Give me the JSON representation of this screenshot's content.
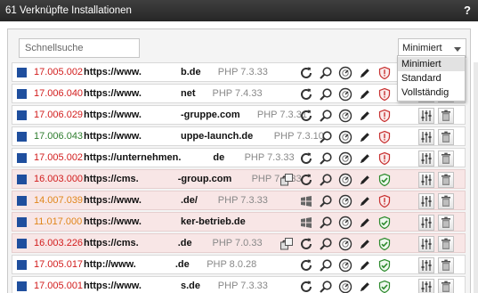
{
  "window": {
    "title": "61 Verknüpfte Installationen",
    "help": "?"
  },
  "search": {
    "placeholder": "Schnellsuche",
    "value": ""
  },
  "view_select": {
    "value": "Minimiert",
    "options": [
      "Minimiert",
      "Standard",
      "Vollständig"
    ],
    "highlighted": "Minimiert"
  },
  "colors": {
    "red": "#d21d1d",
    "green": "#2e7d2e",
    "orange": "#e0861a",
    "blue_square": "#1f4f9e",
    "alt_row": "#f8e6e6",
    "titlebar": "#2e2e2e"
  },
  "rows": [
    {
      "version": "17.005.002",
      "version_color": "red",
      "url": "https://www.",
      "url_tail": "b.de",
      "php": "PHP 7.3.33",
      "alt": false,
      "icons": [
        "refresh-icon",
        "search-icon",
        "dashboard-icon",
        "pencil-icon",
        "shield-warning-icon"
      ]
    },
    {
      "version": "17.006.040",
      "version_color": "red",
      "url": "https://www.",
      "url_tail": "net",
      "php": "PHP 7.4.33",
      "alt": false,
      "icons": [
        "refresh-icon",
        "search-icon",
        "dashboard-icon",
        "pencil-icon",
        "shield-warning-icon"
      ]
    },
    {
      "version": "17.006.029",
      "version_color": "red",
      "url": "https://www.",
      "url_tail": "-gruppe.com",
      "php": "PHP 7.3.31",
      "alt": false,
      "icons": [
        "refresh-icon",
        "search-icon",
        "dashboard-icon",
        "pencil-icon",
        "shield-warning-icon"
      ]
    },
    {
      "version": "17.006.043",
      "version_color": "green",
      "url": "https://www.",
      "url_tail": "uppe-launch.de",
      "php": "PHP 7.3.10",
      "alt": false,
      "icons": [
        "search-icon",
        "dashboard-icon",
        "pencil-icon",
        "shield-warning-icon"
      ]
    },
    {
      "version": "17.005.002",
      "version_color": "red",
      "url": "https://unternehmen.",
      "url_tail": "de",
      "php": "PHP 7.3.33",
      "alt": false,
      "icons": [
        "refresh-icon",
        "search-icon",
        "dashboard-icon",
        "pencil-icon",
        "shield-warning-icon"
      ]
    },
    {
      "version": "16.003.000",
      "version_color": "red",
      "url": "https://cms.",
      "url_tail": "-group.com",
      "php": "PHP 7.0.33",
      "alt": true,
      "icons": [
        "transfer-icon",
        "refresh-icon",
        "search-icon",
        "dashboard-icon",
        "pencil-icon",
        "shield-ok-icon"
      ]
    },
    {
      "version": "14.007.039",
      "version_color": "orange",
      "url": "https://www.",
      "url_tail": ".de/",
      "php": "PHP 7.3.33",
      "alt": true,
      "icons": [
        "windows-icon",
        "search-icon",
        "dashboard-icon",
        "pencil-icon",
        "shield-warning-icon"
      ]
    },
    {
      "version": "11.017.000",
      "version_color": "orange",
      "url": "https://www.",
      "url_tail": "ker-betrieb.de",
      "php": "",
      "alt": true,
      "icons": [
        "windows-icon",
        "search-icon",
        "dashboard-icon",
        "pencil-icon",
        "shield-ok-icon"
      ]
    },
    {
      "version": "16.003.226",
      "version_color": "red",
      "url": "https://cms.",
      "url_tail": ".de",
      "php": "PHP 7.0.33",
      "alt": true,
      "icons": [
        "transfer-icon",
        "refresh-icon",
        "search-icon",
        "dashboard-icon",
        "pencil-icon",
        "shield-ok-icon"
      ]
    },
    {
      "version": "17.005.017",
      "version_color": "red",
      "url": "http://www.",
      "url_tail": ".de",
      "php": "PHP 8.0.28",
      "alt": false,
      "icons": [
        "refresh-icon",
        "search-icon",
        "dashboard-icon",
        "pencil-icon",
        "shield-ok-icon"
      ]
    },
    {
      "version": "17.005.001",
      "version_color": "red",
      "url": "https://www.",
      "url_tail": "s.de",
      "php": "PHP 7.3.33",
      "alt": false,
      "icons": [
        "refresh-icon",
        "search-icon",
        "dashboard-icon",
        "pencil-icon",
        "shield-ok-icon"
      ]
    }
  ],
  "row_tools": [
    "settings-sliders-icon",
    "trash-icon"
  ]
}
